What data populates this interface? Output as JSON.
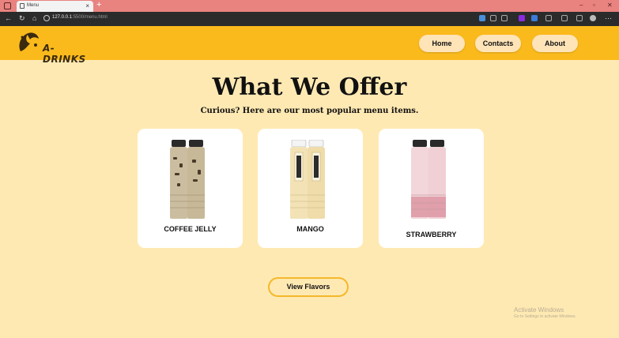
{
  "browser": {
    "tab_title": "Menu",
    "tab_close": "×",
    "new_tab": "+",
    "url_host": "127.0.0.1",
    "url_rest": ":5500/menu.html"
  },
  "header": {
    "logo_text": "A-DRINKS",
    "nav": [
      {
        "label": "Home"
      },
      {
        "label": "Contacts"
      },
      {
        "label": "About"
      }
    ],
    "accent_color": "#fbba1c"
  },
  "main": {
    "title": "What We Offer",
    "subtitle": "Curious? Here are our most popular menu items.",
    "items": [
      {
        "name": "COFFEE JELLY"
      },
      {
        "name": "MANGO"
      },
      {
        "name": "STRAWBERRY"
      }
    ],
    "cta_label": "View Flavors"
  },
  "watermark": {
    "line1": "Activate Windows",
    "line2": "Go to Settings to activate Windows."
  }
}
